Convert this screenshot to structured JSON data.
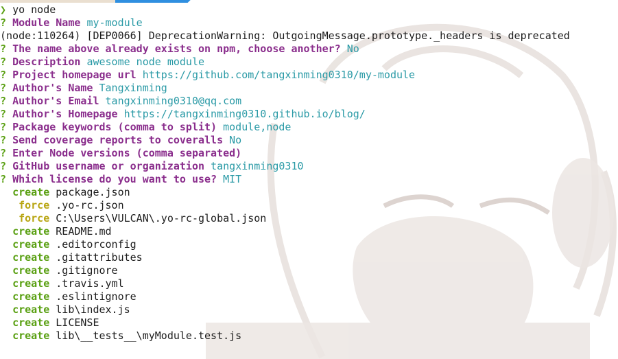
{
  "prompt_line": {
    "arrow": "❯",
    "command": "yo node"
  },
  "lines": [
    {
      "id": "module-name",
      "q": "?",
      "label": "Module Name",
      "value": "my-module"
    },
    {
      "id": "deprecation",
      "text": "(node:110264) [DEP0066] DeprecationWarning: OutgoingMessage.prototype._headers is deprecated"
    },
    {
      "id": "name-exists",
      "q": "?",
      "label": "The name above already exists on npm, choose another?",
      "value": "No"
    },
    {
      "id": "description",
      "q": "?",
      "label": "Description",
      "value": "awesome node module"
    },
    {
      "id": "homepage-url",
      "q": "?",
      "label": "Project homepage url",
      "value": "https://github.com/tangxinming0310/my-module"
    },
    {
      "id": "author-name",
      "q": "?",
      "label": "Author's Name",
      "value": "Tangxinming"
    },
    {
      "id": "author-email",
      "q": "?",
      "label": "Author's Email",
      "value": "tangxinming0310@qq.com"
    },
    {
      "id": "author-homepage",
      "q": "?",
      "label": "Author's Homepage",
      "value": "https://tangxinming0310.github.io/blog/"
    },
    {
      "id": "keywords",
      "q": "?",
      "label": "Package keywords (comma to split)",
      "value": "module,node"
    },
    {
      "id": "coveralls",
      "q": "?",
      "label": "Send coverage reports to coveralls",
      "value": "No"
    },
    {
      "id": "node-versions",
      "q": "?",
      "label": "Enter Node versions (comma separated)",
      "value": ""
    },
    {
      "id": "github-username",
      "q": "?",
      "label": "GitHub username or organization",
      "value": "tangxinming0310"
    },
    {
      "id": "license",
      "q": "?",
      "label": "Which license do you want to use?",
      "value": "MIT"
    }
  ],
  "files": [
    {
      "action": "create",
      "path": "package.json",
      "color": "#5aa013"
    },
    {
      "action": " force",
      "path": ".yo-rc.json",
      "color": "#b8a512"
    },
    {
      "action": " force",
      "path": "C:\\Users\\VULCAN\\.yo-rc-global.json",
      "color": "#b8a512"
    },
    {
      "action": "create",
      "path": "README.md",
      "color": "#5aa013"
    },
    {
      "action": "create",
      "path": ".editorconfig",
      "color": "#5aa013"
    },
    {
      "action": "create",
      "path": ".gitattributes",
      "color": "#5aa013"
    },
    {
      "action": "create",
      "path": ".gitignore",
      "color": "#5aa013"
    },
    {
      "action": "create",
      "path": ".travis.yml",
      "color": "#5aa013"
    },
    {
      "action": "create",
      "path": ".eslintignore",
      "color": "#5aa013"
    },
    {
      "action": "create",
      "path": "lib\\index.js",
      "color": "#5aa013"
    },
    {
      "action": "create",
      "path": "LICENSE",
      "color": "#5aa013"
    },
    {
      "action": "create",
      "path": "lib\\__tests__\\myModule.test.js",
      "color": "#5aa013"
    }
  ]
}
